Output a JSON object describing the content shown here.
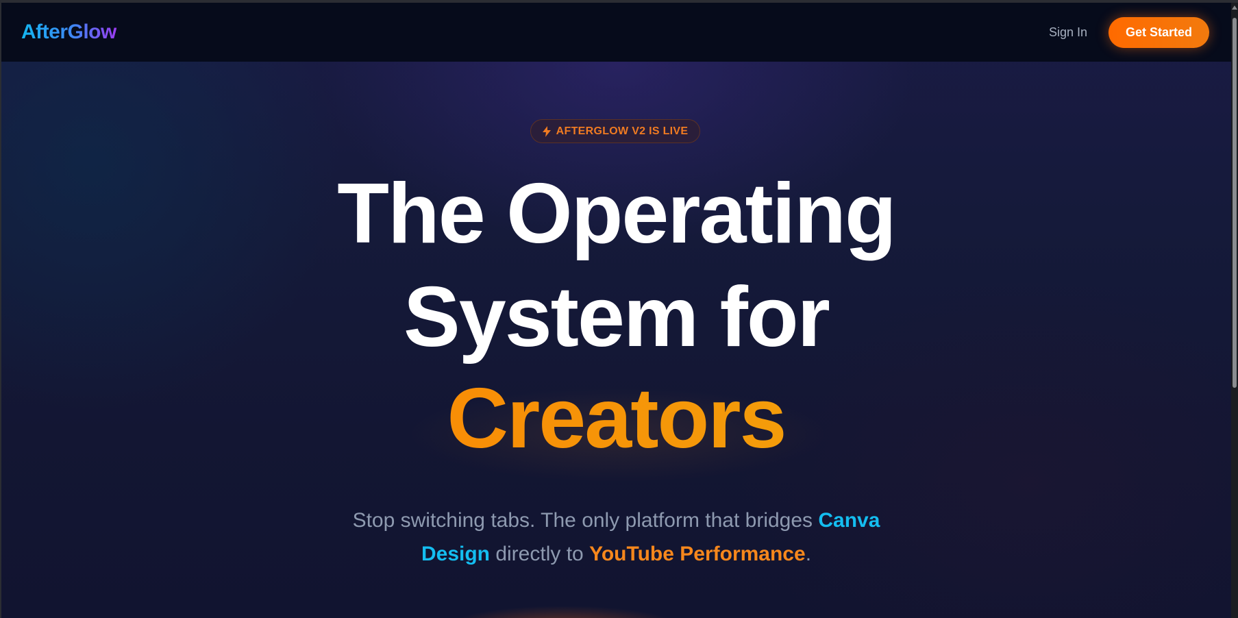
{
  "nav": {
    "logo": "AfterGlow",
    "sign_in": "Sign In",
    "cta": "Get Started"
  },
  "hero": {
    "badge": "AFTERGLOW V2 IS LIVE",
    "badge_icon": "lightning-bolt-icon",
    "headline_line1": "The Operating",
    "headline_line2": "System for",
    "headline_line3": "Creators",
    "subtitle": {
      "part1": "Stop switching tabs. The only platform that bridges ",
      "highlight1a": "Canva",
      "highlight1b": "Design",
      "part2": " directly to ",
      "highlight2": "YouTube Performance",
      "part3": "."
    }
  },
  "colors": {
    "accent_orange": "#ff6a00",
    "accent_cyan": "#14bdf0",
    "logo_purple": "#9a3cf0",
    "background": "#131633",
    "navbar": "#060b1b"
  }
}
